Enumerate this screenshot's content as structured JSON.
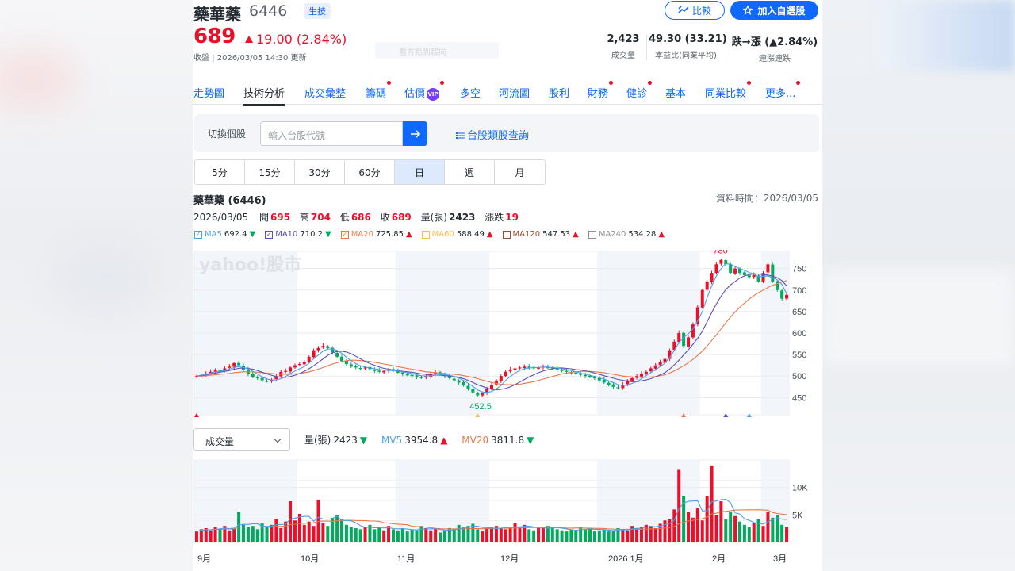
{
  "stock": {
    "name": "藥華藥",
    "code": "6446",
    "category": "生技",
    "price": "689",
    "change": "19.00 (2.84%)",
    "close_time": "收盤 | 2026/03/05 14:30 更新",
    "ghost_text": "看方點到趨向"
  },
  "buttons": {
    "compare": "比較",
    "watchlist": "加入自選股"
  },
  "stats": [
    {
      "value": "2,423",
      "label": "成交量"
    },
    {
      "value": "49.30 (33.21)",
      "label": "本益比(同業平均)"
    },
    {
      "value": "跌→漲 (▲2.84%)",
      "label": "連漲連跌"
    }
  ],
  "tabs": [
    {
      "label": "走勢圖",
      "dot": false,
      "vip": false
    },
    {
      "label": "技術分析",
      "dot": false,
      "vip": false,
      "active": true
    },
    {
      "label": "成交彙整",
      "dot": false,
      "vip": false
    },
    {
      "label": "籌碼",
      "dot": true,
      "vip": false
    },
    {
      "label": "估價",
      "dot": true,
      "vip": true
    },
    {
      "label": "多空",
      "dot": false,
      "vip": false
    },
    {
      "label": "河流圖",
      "dot": false,
      "vip": false
    },
    {
      "label": "股利",
      "dot": false,
      "vip": false
    },
    {
      "label": "財務",
      "dot": true,
      "vip": false
    },
    {
      "label": "健診",
      "dot": true,
      "vip": false
    },
    {
      "label": "基本",
      "dot": false,
      "vip": false
    },
    {
      "label": "同業比較",
      "dot": true,
      "vip": false
    },
    {
      "label": "更多...",
      "dot": true,
      "vip": false
    }
  ],
  "switcher": {
    "label": "切換個股",
    "placeholder": "輸入台股代號",
    "category_link": "台股類股查詢"
  },
  "periods": [
    "5分",
    "15分",
    "30分",
    "60分",
    "日",
    "週",
    "月"
  ],
  "active_period": "日",
  "chart_title": "藥華藥 (6446)",
  "data_time": "資料時間：2026/03/05",
  "ohlc": {
    "date": "2026/03/05",
    "open_label": "開",
    "open": "695",
    "high_label": "高",
    "high": "704",
    "low_label": "低",
    "low": "686",
    "close_label": "收",
    "close": "689",
    "vol_label": "量(張)",
    "vol": "2423",
    "chg_label": "漲跌",
    "chg": "19"
  },
  "ma": [
    {
      "name": "MA5",
      "value": "692.4",
      "dir": "down",
      "color": "#4ea0e6"
    },
    {
      "name": "MA10",
      "value": "710.2",
      "dir": "down",
      "color": "#5a4fb8"
    },
    {
      "name": "MA20",
      "value": "725.85",
      "dir": "up",
      "color": "#e8784a"
    },
    {
      "name": "MA60",
      "value": "588.49",
      "dir": "up",
      "color": "#f3c04a"
    },
    {
      "name": "MA120",
      "value": "547.53",
      "dir": "up",
      "color": "#a34a2f"
    },
    {
      "name": "MA240",
      "value": "534.28",
      "dir": "up",
      "color": "#8d8d8d"
    }
  ],
  "volume_select": "成交量",
  "volume_row": {
    "vol_label": "量(張)",
    "vol": "2423",
    "vol_dir": "down",
    "mv5_label": "MV5",
    "mv5": "3954.8",
    "mv5_dir": "up",
    "mv20_label": "MV20",
    "mv20": "3811.8",
    "mv20_dir": "down"
  },
  "colors": {
    "accent": "#0f69ff",
    "up": "#eb0f29",
    "down": "#00ab5e"
  },
  "chart_data": [
    {
      "type": "candlestick",
      "title": "",
      "watermark": "yahoo!股市",
      "y_ticks": [
        450,
        500,
        550,
        600,
        650,
        700,
        750
      ],
      "ylim": [
        410,
        790
      ],
      "annotations": [
        {
          "label": "780",
          "value": 780
        },
        {
          "label": "452.5",
          "value": 452.5
        }
      ],
      "x_ticks": [
        "9月",
        "10月",
        "11月",
        "12月",
        "2026 1月",
        "2月",
        "3月"
      ],
      "shaded_months": [
        "9月",
        "11月",
        "2026 1月",
        "3月"
      ],
      "close_series": [
        500,
        502,
        506,
        510,
        515,
        512,
        518,
        522,
        530,
        525,
        515,
        505,
        498,
        495,
        490,
        488,
        492,
        500,
        510,
        512,
        520,
        525,
        528,
        532,
        545,
        560,
        565,
        570,
        565,
        555,
        545,
        535,
        528,
        522,
        520,
        518,
        520,
        516,
        512,
        510,
        512,
        515,
        512,
        508,
        505,
        503,
        500,
        498,
        496,
        500,
        505,
        508,
        505,
        500,
        495,
        490,
        485,
        478,
        470,
        462,
        455,
        460,
        470,
        480,
        490,
        500,
        510,
        515,
        518,
        520,
        522,
        520,
        518,
        520,
        522,
        520,
        518,
        515,
        512,
        510,
        508,
        505,
        503,
        500,
        498,
        495,
        490,
        485,
        480,
        475,
        472,
        480,
        490,
        495,
        500,
        505,
        510,
        518,
        525,
        532,
        540,
        560,
        580,
        600,
        570,
        590,
        620,
        660,
        700,
        720,
        740,
        760,
        770,
        760,
        740,
        750,
        740,
        735,
        730,
        735,
        720,
        740,
        760,
        720,
        700,
        680,
        689
      ],
      "ma5": [
        500,
        502,
        504,
        507,
        510,
        511,
        513,
        516,
        520,
        522,
        520,
        517,
        511,
        505,
        498,
        493,
        491,
        491,
        494,
        499,
        506,
        512,
        517,
        522,
        530,
        540,
        549,
        558,
        563,
        563,
        560,
        553,
        544,
        536,
        529,
        524,
        521,
        519,
        517,
        515,
        514,
        513,
        513,
        512,
        510,
        508,
        506,
        503,
        501,
        500,
        501,
        502,
        503,
        503,
        502,
        499,
        495,
        490,
        483,
        476,
        468,
        463,
        462,
        464,
        470,
        478,
        490,
        499,
        507,
        513,
        517,
        519,
        520,
        520,
        521,
        521,
        520,
        519,
        517,
        515,
        513,
        510,
        507,
        504,
        502,
        499,
        496,
        493,
        489,
        485,
        480,
        478,
        479,
        483,
        487,
        494,
        501,
        508,
        515,
        522,
        530,
        543,
        559,
        578,
        590,
        598,
        610,
        628,
        650,
        682,
        710,
        733,
        750,
        762,
        760,
        755,
        750,
        746,
        741,
        738,
        731,
        732,
        733,
        729,
        724,
        713,
        692
      ],
      "ma10": [
        500,
        501,
        503,
        505,
        507,
        509,
        511,
        513,
        516,
        518,
        519,
        518,
        516,
        513,
        509,
        505,
        502,
        499,
        497,
        497,
        499,
        502,
        506,
        511,
        517,
        524,
        532,
        540,
        548,
        554,
        557,
        558,
        556,
        552,
        546,
        540,
        534,
        529,
        525,
        521,
        518,
        516,
        514,
        513,
        511,
        510,
        509,
        507,
        505,
        504,
        502,
        502,
        502,
        501,
        500,
        499,
        497,
        494,
        490,
        485,
        480,
        476,
        472,
        469,
        468,
        469,
        471,
        475,
        480,
        486,
        492,
        498,
        503,
        508,
        512,
        515,
        517,
        519,
        519,
        518,
        517,
        515,
        514,
        512,
        510,
        507,
        504,
        501,
        498,
        495,
        492,
        490,
        488,
        487,
        487,
        489,
        491,
        494,
        498,
        503,
        508,
        516,
        526,
        537,
        549,
        561,
        574,
        588,
        604,
        626,
        648,
        668,
        686,
        701,
        712,
        720,
        728,
        733,
        736,
        738,
        737,
        736,
        735,
        732,
        729,
        722,
        710
      ],
      "ma20": [
        500,
        500,
        501,
        502,
        503,
        504,
        505,
        506,
        508,
        509,
        510,
        510,
        510,
        509,
        508,
        507,
        506,
        505,
        504,
        504,
        504,
        505,
        506,
        508,
        510,
        513,
        516,
        520,
        524,
        528,
        531,
        534,
        536,
        537,
        537,
        536,
        535,
        534,
        532,
        530,
        528,
        526,
        524,
        522,
        520,
        518,
        516,
        514,
        512,
        510,
        509,
        508,
        507,
        506,
        505,
        504,
        503,
        501,
        499,
        497,
        494,
        491,
        488,
        485,
        483,
        481,
        480,
        480,
        480,
        481,
        483,
        485,
        487,
        490,
        493,
        496,
        499,
        502,
        505,
        507,
        509,
        510,
        511,
        511,
        511,
        510,
        509,
        508,
        506,
        504,
        502,
        500,
        499,
        498,
        497,
        497,
        497,
        498,
        499,
        501,
        503,
        507,
        512,
        518,
        524,
        531,
        539,
        548,
        558,
        570,
        583,
        596,
        610,
        624,
        637,
        649,
        660,
        670,
        679,
        687,
        694,
        700,
        706,
        711,
        715,
        719,
        722
      ],
      "volume": [
        2.0,
        2.4,
        2.6,
        2.2,
        2.8,
        2.4,
        3.0,
        2.2,
        2.6,
        5.5,
        3.2,
        2.8,
        3.0,
        2.4,
        3.5,
        2.8,
        3.2,
        4.2,
        2.6,
        3.8,
        7.5,
        4.0,
        5.2,
        3.2,
        3.8,
        3.0,
        7.8,
        3.5,
        3.0,
        4.5,
        5.0,
        4.2,
        3.2,
        2.8,
        2.6,
        2.4,
        2.8,
        3.2,
        2.4,
        2.6,
        2.2,
        3.0,
        2.4,
        2.2,
        2.6,
        2.0,
        2.4,
        2.2,
        3.0,
        2.6,
        2.2,
        2.4,
        1.8,
        2.2,
        2.6,
        2.4,
        3.2,
        2.8,
        3.0,
        3.4,
        2.4,
        2.0,
        2.6,
        2.8,
        3.0,
        2.6,
        2.4,
        2.8,
        3.5,
        2.8,
        3.2,
        2.4,
        2.2,
        2.6,
        2.8,
        3.0,
        2.6,
        2.4,
        2.2,
        2.0,
        2.4,
        2.2,
        2.8,
        2.4,
        2.6,
        2.0,
        2.2,
        2.4,
        2.0,
        2.2,
        2.6,
        2.4,
        2.2,
        3.0,
        2.6,
        2.8,
        3.2,
        3.0,
        2.6,
        3.4,
        4.0,
        4.2,
        6.0,
        13.2,
        8.5,
        5.5,
        4.5,
        6.2,
        4.0,
        8.5,
        14.0,
        5.0,
        7.5,
        4.2,
        5.5,
        4.8,
        3.8,
        3.2,
        2.8,
        3.5,
        4.2,
        3.0,
        5.5,
        4.5,
        5.0,
        3.2,
        2.8
      ],
      "vol_y_ticks": [
        {
          "label": "5K",
          "value": 5
        },
        {
          "label": "10K",
          "value": 10
        }
      ],
      "vol_ylim": [
        0,
        15
      ]
    }
  ]
}
